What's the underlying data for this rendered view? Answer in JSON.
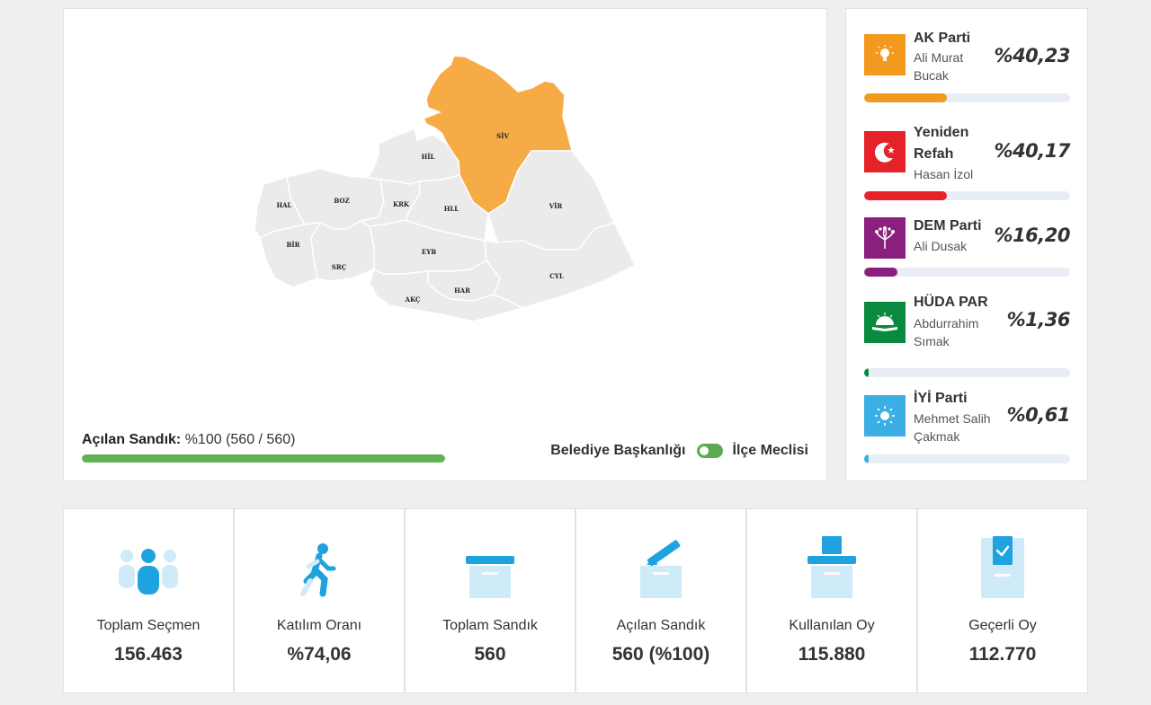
{
  "map": {
    "districts": [
      {
        "code": "SİV",
        "won": true
      },
      {
        "code": "HİL",
        "won": false
      },
      {
        "code": "HAL",
        "won": false
      },
      {
        "code": "BOZ",
        "won": false
      },
      {
        "code": "KRK",
        "won": false
      },
      {
        "code": "HLL",
        "won": false
      },
      {
        "code": "VİR",
        "won": false
      },
      {
        "code": "BİR",
        "won": false
      },
      {
        "code": "SRÇ",
        "won": false
      },
      {
        "code": "EYB",
        "won": false
      },
      {
        "code": "HAR",
        "won": false
      },
      {
        "code": "CYL",
        "won": false
      },
      {
        "code": "AKÇ",
        "won": false
      }
    ],
    "winner_color": "#f6ab46",
    "neutral_color": "#ebebeb"
  },
  "progress": {
    "label": "Açılan Sandık:",
    "value_text": "%100 (560 / 560)",
    "fraction": 1.0,
    "color": "#62b158"
  },
  "toggle": {
    "left_label": "Belediye Başkanlığı",
    "right_label": "İlçe Meclisi",
    "on": true
  },
  "parties": [
    {
      "name": "AK Parti",
      "candidate_line1": "Ali Murat",
      "candidate_line2": "Bucak",
      "percent_text": "%40,23",
      "percent": 40.23,
      "color": "#f39a1e",
      "icon": "lightbulb-icon"
    },
    {
      "name_line1": "Yeniden",
      "name_line2": "Refah",
      "candidate": "Hasan İzol",
      "percent_text": "%40,17",
      "percent": 40.17,
      "color": "#e42228",
      "icon": "crescent-icon"
    },
    {
      "name": "DEM Parti",
      "candidate": "Ali Dusak",
      "percent_text": "%16,20",
      "percent": 16.2,
      "color": "#8a1f7e",
      "icon": "tree-icon"
    },
    {
      "name": "HÜDA PAR",
      "candidate_line1": "Abdurrahim",
      "candidate_line2": "Sımak",
      "percent_text": "%1,36",
      "percent": 1.36,
      "color": "#0a8a3e",
      "icon": "book-sunrise-icon"
    },
    {
      "name": "İYİ Parti",
      "candidate_line1": "Mehmet Salih",
      "candidate_line2": "Çakmak",
      "percent_text": "%0,61",
      "percent": 0.61,
      "color": "#3aaee5",
      "icon": "sun-icon"
    }
  ],
  "stats": [
    {
      "label": "Toplam Seçmen",
      "value": "156.463",
      "icon": "voters-icon"
    },
    {
      "label": "Katılım Oranı",
      "value": "%74,06",
      "icon": "walking-person-icon"
    },
    {
      "label": "Toplam Sandık",
      "value": "560",
      "icon": "ballot-box-icon"
    },
    {
      "label": "Açılan Sandık",
      "value": "560 (%100)",
      "icon": "opened-box-icon"
    },
    {
      "label": "Kullanılan Oy",
      "value": "115.880",
      "icon": "ballot-cast-icon"
    },
    {
      "label": "Geçerli Oy",
      "value": "112.770",
      "icon": "valid-vote-icon"
    }
  ],
  "colors": {
    "accent_blue": "#1fa3e0",
    "light_blue": "#cfeaf8"
  }
}
